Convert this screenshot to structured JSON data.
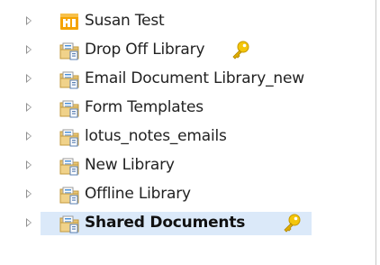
{
  "tree": {
    "items": [
      {
        "label": "Susan Test",
        "icon": "site-icon",
        "selected": false,
        "has_key": false
      },
      {
        "label": "Drop Off Library",
        "icon": "library-icon",
        "selected": false,
        "has_key": true
      },
      {
        "label": "Email Document Library_new",
        "icon": "library-icon",
        "selected": false,
        "has_key": false
      },
      {
        "label": "Form Templates",
        "icon": "library-icon",
        "selected": false,
        "has_key": false
      },
      {
        "label": "lotus_notes_emails",
        "icon": "library-icon",
        "selected": false,
        "has_key": false
      },
      {
        "label": "New Library",
        "icon": "library-icon",
        "selected": false,
        "has_key": false
      },
      {
        "label": "Offline Library",
        "icon": "library-icon",
        "selected": false,
        "has_key": false
      },
      {
        "label": "Shared Documents",
        "icon": "library-icon",
        "selected": true,
        "has_key": true
      }
    ]
  },
  "colors": {
    "selection": "#dbe9f9",
    "site_icon": "#f0a000",
    "library_folder": "#e8c470",
    "key": "#f2c200"
  }
}
